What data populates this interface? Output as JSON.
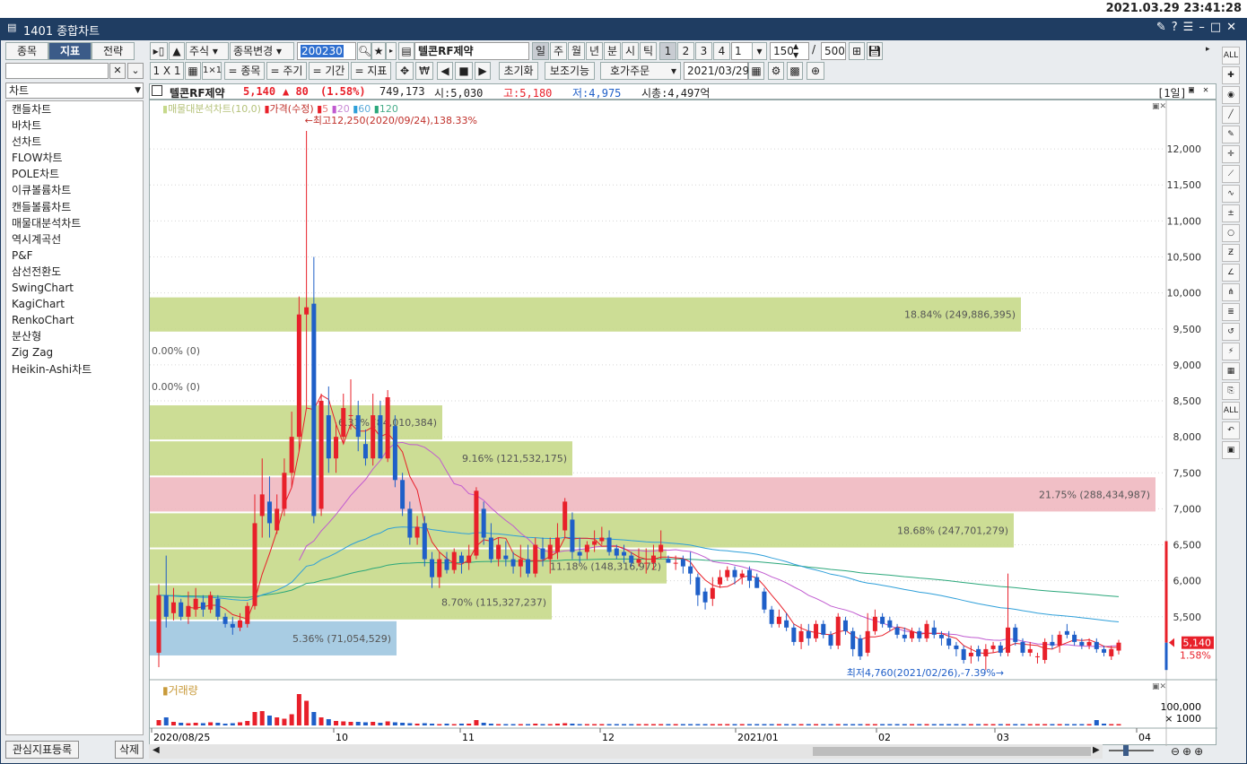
{
  "clock": "2021.03.29 23:41:28",
  "window": {
    "title": "1401 종합차트"
  },
  "left_tabs": [
    "종목",
    "지표",
    "전략"
  ],
  "left_select": "차트",
  "chart_types": [
    "캔들차트",
    "바차트",
    "선차트",
    "FLOW차트",
    "POLE차트",
    "이큐볼륨차트",
    "캔들볼륨차트",
    "매물대분석차트",
    "역시계곡선",
    "P&F",
    "삼선전환도",
    "SwingChart",
    "KagiChart",
    "RenkoChart",
    "분산형",
    "Zig Zag",
    "Heikin-Ashi차트"
  ],
  "left_buttons": {
    "register": "관심지표등록",
    "delete": "삭제"
  },
  "toolbar": {
    "market": "주식",
    "change": "종목변경",
    "code": "200230",
    "name": "텔콘RF제약",
    "periods": [
      "일",
      "주",
      "월",
      "년",
      "분",
      "시",
      "틱"
    ],
    "nums": [
      "1",
      "2",
      "3",
      "4"
    ],
    "unit": "1",
    "count": "150",
    "max": "500",
    "layout": "1 X 1",
    "toggle_labels": [
      "= 종목",
      "= 주기",
      "= 기간",
      "= 지표"
    ],
    "reset": "초기화",
    "aux": "보조기능",
    "order": "호가주문",
    "date": "2021/03/29"
  },
  "info": {
    "name": "텔콘RF제약",
    "price": "5,140",
    "change": "▲ 80",
    "rate": "(1.58%)",
    "volume": "749,173",
    "open": "시:5,030",
    "high": "고:5,180",
    "low": "저:4,975",
    "mcap": "시총:4,497억",
    "period": "[1일]"
  },
  "legend": {
    "volume_profile": "매물대분석차트(10,0)",
    "price": "가격(수정)",
    "ma": [
      "5",
      "20",
      "60",
      "120"
    ]
  },
  "annotations": {
    "high": "최고12,250(2020/09/24),138.33%",
    "low": "최저4,760(2021/02/26),-7.39%"
  },
  "volume_label": "거래량",
  "volume_axis": [
    "100,000",
    "× 1000"
  ],
  "price_tag": {
    "price": "5,140",
    "rate": "1.58%"
  },
  "colors": {
    "up": "#e8202a",
    "down": "#1f5fc8",
    "profile": "#c6d98a",
    "profile_max": "#f0b8c0",
    "profile_cur": "#9fc6e0",
    "ma5": "#e8202a",
    "ma20": "#c05ad0",
    "ma60": "#2e9fd9",
    "ma120": "#2aa77a"
  },
  "chart_data": {
    "type": "candlestick",
    "x_labels": [
      "2020/08/25",
      "10",
      "11",
      "12",
      "2021/01",
      "02",
      "03",
      "04"
    ],
    "y_ticks": [
      5500,
      6000,
      6500,
      7000,
      7500,
      8000,
      8500,
      9000,
      9500,
      10000,
      10500,
      11000,
      11500,
      12000
    ],
    "ylim": [
      4700,
      12450
    ],
    "price_profile": [
      {
        "low": 4950,
        "high": 5450,
        "pct": "5.36%",
        "vol": "(71,054,529)"
      },
      {
        "low": 5450,
        "high": 5950,
        "pct": "8.70%",
        "vol": "(115,327,237)"
      },
      {
        "low": 5950,
        "high": 6450,
        "pct": "11.18%",
        "vol": "(148,316,972)"
      },
      {
        "low": 6450,
        "high": 6950,
        "pct": "18.68%",
        "vol": "(247,701,279)"
      },
      {
        "low": 6950,
        "high": 7450,
        "pct": "21.75%",
        "vol": "(288,434,987)"
      },
      {
        "low": 7450,
        "high": 7950,
        "pct": "9.16%",
        "vol": "(121,532,175)"
      },
      {
        "low": 7950,
        "high": 8450,
        "pct": "6.33%",
        "vol": "(84,010,384)"
      },
      {
        "low": 8450,
        "high": 8950,
        "pct": "0.00%",
        "vol": "(0)"
      },
      {
        "low": 8950,
        "high": 9450,
        "pct": "0.00%",
        "vol": "(0)"
      },
      {
        "low": 9450,
        "high": 9950,
        "pct": "18.84%",
        "vol": "(249,886,395)"
      }
    ],
    "candles": [
      [
        5000,
        5800,
        4800,
        5950
      ],
      [
        5800,
        5500,
        5350,
        6350
      ],
      [
        5550,
        5700,
        5450,
        5900
      ],
      [
        5700,
        5500,
        5450,
        5750
      ],
      [
        5500,
        5650,
        5400,
        5850
      ],
      [
        5600,
        5750,
        5500,
        5900
      ],
      [
        5700,
        5600,
        5500,
        5800
      ],
      [
        5600,
        5800,
        5550,
        5850
      ],
      [
        5750,
        5500,
        5450,
        5800
      ],
      [
        5500,
        5400,
        5350,
        5550
      ],
      [
        5400,
        5350,
        5250,
        5500
      ],
      [
        5350,
        5450,
        5300,
        5550
      ],
      [
        5400,
        5650,
        5350,
        5700
      ],
      [
        5650,
        6800,
        5600,
        7200
      ],
      [
        6900,
        7200,
        6600,
        7700
      ],
      [
        7100,
        6800,
        6600,
        7450
      ],
      [
        6700,
        7000,
        6650,
        7200
      ],
      [
        7000,
        7500,
        6900,
        7700
      ],
      [
        7500,
        8000,
        7300,
        8350
      ],
      [
        8000,
        9700,
        7800,
        9950
      ],
      [
        9700,
        9800,
        8400,
        12250
      ],
      [
        9850,
        6900,
        6800,
        10500
      ],
      [
        7000,
        8500,
        6900,
        8600
      ],
      [
        8300,
        7700,
        7500,
        8700
      ],
      [
        7700,
        8000,
        7500,
        8200
      ],
      [
        8000,
        8400,
        7900,
        8600
      ],
      [
        8300,
        8300,
        8100,
        8800
      ],
      [
        8300,
        8000,
        7800,
        8500
      ],
      [
        7900,
        7700,
        7600,
        8100
      ],
      [
        7700,
        8300,
        7600,
        8600
      ],
      [
        8300,
        7700,
        7700,
        8500
      ],
      [
        7700,
        8550,
        7650,
        8650
      ],
      [
        8150,
        7400,
        7300,
        8300
      ],
      [
        7400,
        7000,
        6900,
        7500
      ],
      [
        7000,
        6600,
        6500,
        7100
      ],
      [
        6600,
        6750,
        6500,
        6900
      ],
      [
        6800,
        6300,
        6200,
        6900
      ],
      [
        6300,
        6050,
        5900,
        6400
      ],
      [
        6050,
        6300,
        5900,
        6400
      ],
      [
        6300,
        6150,
        6100,
        6400
      ],
      [
        6150,
        6400,
        6100,
        6450
      ],
      [
        6350,
        6250,
        6100,
        6400
      ],
      [
        6250,
        6350,
        6150,
        6500
      ],
      [
        6350,
        7250,
        6300,
        7300
      ],
      [
        7000,
        6600,
        6500,
        7100
      ],
      [
        6600,
        6300,
        6250,
        6800
      ],
      [
        6300,
        6500,
        6200,
        6600
      ],
      [
        6350,
        6300,
        6200,
        6550
      ],
      [
        6300,
        6200,
        6100,
        6400
      ],
      [
        6200,
        6300,
        6050,
        6500
      ],
      [
        6300,
        6100,
        6050,
        6500
      ],
      [
        6100,
        6500,
        6050,
        6600
      ],
      [
        6450,
        6300,
        6200,
        6600
      ],
      [
        6300,
        6500,
        6100,
        6600
      ],
      [
        6400,
        6600,
        6300,
        6800
      ],
      [
        6700,
        7100,
        6600,
        7150
      ],
      [
        6850,
        6400,
        6300,
        6950
      ],
      [
        6400,
        6350,
        6250,
        6600
      ],
      [
        6400,
        6500,
        6300,
        6550
      ],
      [
        6500,
        6550,
        6400,
        6700
      ],
      [
        6550,
        6600,
        6500,
        6750
      ],
      [
        6600,
        6400,
        6350,
        6700
      ],
      [
        6450,
        6350,
        6300,
        6500
      ],
      [
        6400,
        6350,
        6250,
        6500
      ],
      [
        6350,
        6250,
        6200,
        6400
      ],
      [
        6250,
        6300,
        6200,
        6450
      ],
      [
        6250,
        6250,
        6100,
        6450
      ],
      [
        6250,
        6350,
        6150,
        6500
      ],
      [
        6400,
        6500,
        6300,
        6700
      ],
      [
        6300,
        6250,
        6250,
        6350
      ],
      [
        6250,
        6250,
        6150,
        6350
      ],
      [
        6300,
        6200,
        6100,
        6350
      ],
      [
        6200,
        6100,
        5950,
        6400
      ],
      [
        6050,
        5800,
        5650,
        6100
      ],
      [
        5850,
        5700,
        5600,
        5900
      ],
      [
        5750,
        5900,
        5650,
        6050
      ],
      [
        5950,
        6050,
        5900,
        6150
      ],
      [
        6050,
        6150,
        6000,
        6200
      ],
      [
        6150,
        6050,
        5950,
        6200
      ],
      [
        6050,
        6100,
        5950,
        6150
      ],
      [
        6150,
        6000,
        5900,
        6200
      ],
      [
        6050,
        5900,
        5900,
        6100
      ],
      [
        5850,
        5600,
        5550,
        5900
      ],
      [
        5600,
        5400,
        5350,
        5650
      ],
      [
        5400,
        5500,
        5350,
        5600
      ],
      [
        5450,
        5350,
        5300,
        5550
      ],
      [
        5350,
        5150,
        5100,
        5400
      ],
      [
        5150,
        5300,
        5050,
        5400
      ],
      [
        5300,
        5200,
        5100,
        5400
      ],
      [
        5200,
        5400,
        5150,
        5450
      ],
      [
        5400,
        5250,
        5200,
        5450
      ],
      [
        5250,
        5100,
        5050,
        5300
      ],
      [
        5100,
        5500,
        5050,
        5550
      ],
      [
        5450,
        5300,
        5250,
        5500
      ],
      [
        5300,
        5050,
        4950,
        5350
      ],
      [
        5200,
        4950,
        4900,
        5250
      ],
      [
        5000,
        5300,
        4950,
        5550
      ],
      [
        5300,
        5500,
        5250,
        5600
      ],
      [
        5500,
        5400,
        5350,
        5550
      ],
      [
        5450,
        5350,
        5300,
        5500
      ],
      [
        5350,
        5250,
        5200,
        5400
      ],
      [
        5250,
        5200,
        5150,
        5350
      ],
      [
        5200,
        5300,
        5150,
        5350
      ],
      [
        5300,
        5200,
        5150,
        5350
      ],
      [
        5200,
        5400,
        5150,
        5450
      ],
      [
        5350,
        5250,
        5200,
        5450
      ],
      [
        5250,
        5200,
        5100,
        5300
      ],
      [
        5200,
        5100,
        5050,
        5300
      ],
      [
        5100,
        5050,
        4950,
        5150
      ],
      [
        5050,
        4900,
        4850,
        5100
      ],
      [
        4950,
        5000,
        4850,
        5100
      ],
      [
        5050,
        4950,
        4880,
        5100
      ],
      [
        4950,
        5050,
        4760,
        5120
      ],
      [
        5050,
        5100,
        5000,
        5150
      ],
      [
        5100,
        5000,
        4950,
        5150
      ],
      [
        5000,
        5350,
        4950,
        6100
      ],
      [
        5350,
        5150,
        5100,
        5400
      ],
      [
        5150,
        5000,
        4950,
        5200
      ],
      [
        5000,
        5050,
        4950,
        5150
      ],
      [
        4950,
        4950,
        4850,
        5000
      ],
      [
        4900,
        5150,
        4850,
        5200
      ],
      [
        5150,
        5100,
        5050,
        5250
      ],
      [
        5100,
        5250,
        5000,
        5300
      ],
      [
        5300,
        5250,
        5200,
        5400
      ],
      [
        5250,
        5150,
        5100,
        5300
      ],
      [
        5150,
        5100,
        5050,
        5200
      ],
      [
        5100,
        5150,
        5050,
        5200
      ],
      [
        5150,
        5050,
        5000,
        5200
      ],
      [
        5050,
        5000,
        4950,
        5100
      ],
      [
        4950,
        5050,
        4900,
        5100
      ],
      [
        5030,
        5140,
        4975,
        5180
      ]
    ],
    "volumes": [
      12,
      18,
      8,
      6,
      5,
      6,
      5,
      7,
      6,
      4,
      5,
      7,
      10,
      30,
      32,
      22,
      18,
      15,
      25,
      70,
      55,
      30,
      18,
      14,
      10,
      9,
      8,
      8,
      7,
      8,
      6,
      9,
      7,
      6,
      5,
      4,
      5,
      4,
      3,
      4,
      3,
      4,
      4,
      12,
      6,
      4,
      3,
      3,
      3,
      3,
      3,
      4,
      3,
      3,
      4,
      5,
      4,
      3,
      3,
      3,
      3,
      3,
      3,
      3,
      3,
      3,
      3,
      3,
      3,
      3,
      3,
      3,
      3,
      3,
      3,
      3,
      3,
      3,
      3,
      3,
      3,
      3,
      3,
      3,
      3,
      3,
      3,
      3,
      3,
      3,
      3,
      3,
      3,
      3,
      3,
      3,
      3,
      3,
      3,
      3,
      3,
      3,
      3,
      3,
      3,
      3,
      3,
      3,
      3,
      3,
      3,
      3,
      3,
      3,
      3,
      3,
      3,
      3,
      3,
      3,
      3,
      3,
      3,
      3,
      3,
      3,
      3,
      12,
      4,
      3,
      3,
      3,
      3,
      3,
      3,
      3,
      3,
      3,
      3,
      3,
      3,
      4
    ]
  }
}
